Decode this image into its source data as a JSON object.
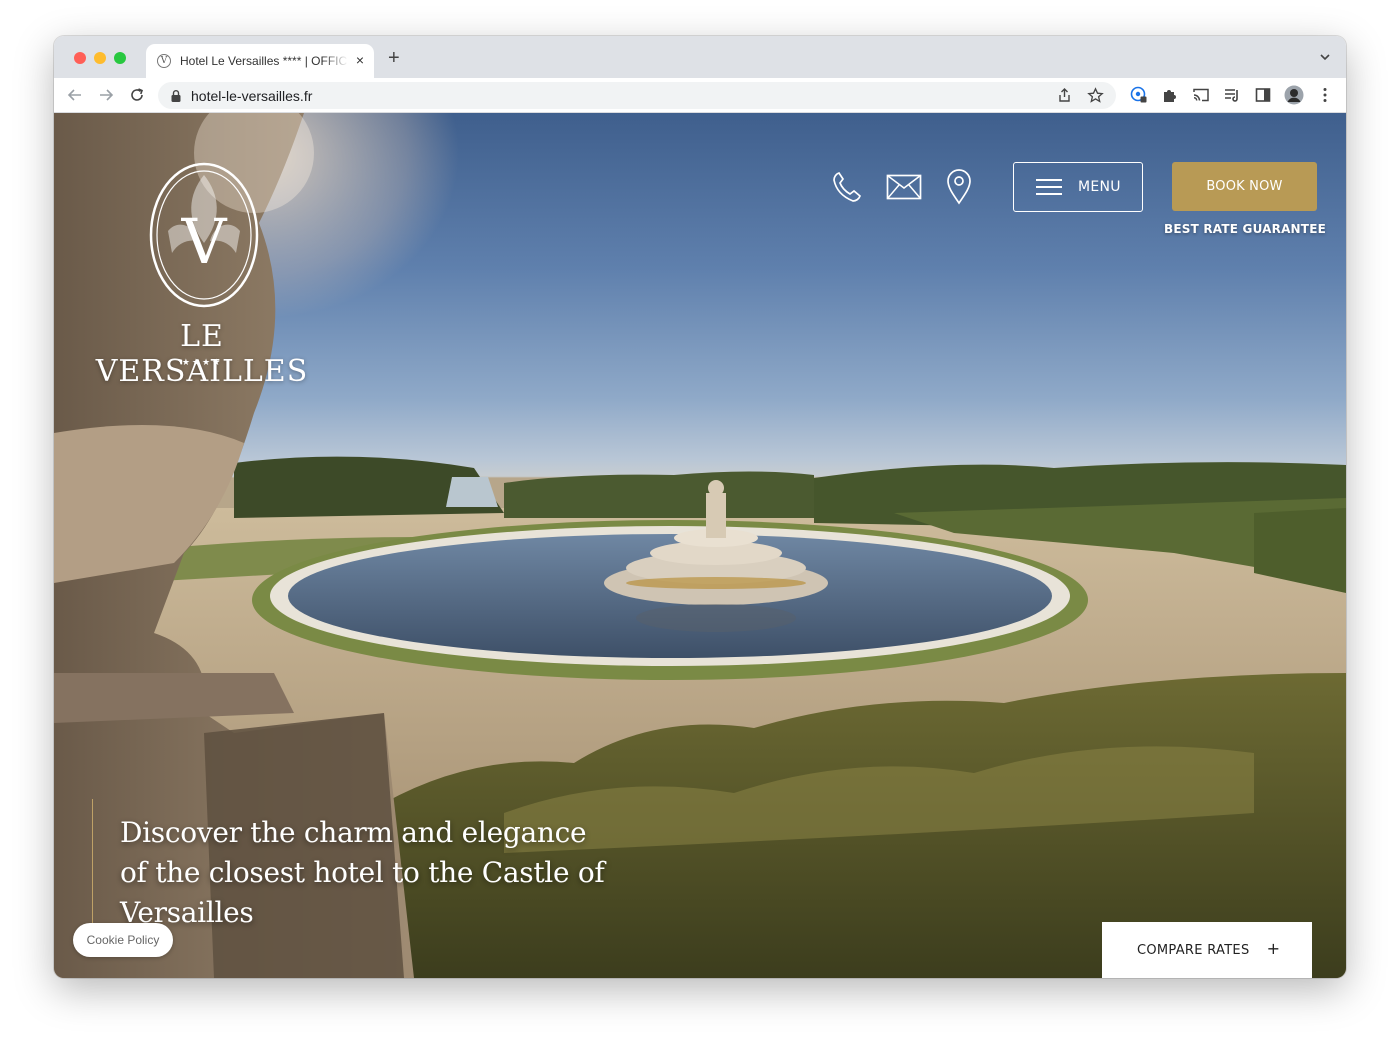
{
  "browser": {
    "tab_title": "Hotel Le Versailles **** | OFFICIAL SITE",
    "tab_favicon": "V",
    "new_tab": "+",
    "tab_close": "×",
    "url": "hotel-le-versailles.fr",
    "icons": [
      "back-icon",
      "forward-icon",
      "reload-icon",
      "lock-icon",
      "share-icon",
      "bookmark-star-icon",
      "extension-icon",
      "puzzle-icon",
      "cast-icon",
      "reading-list-icon",
      "side-panel-icon",
      "profile-avatar",
      "more-icon"
    ]
  },
  "header": {
    "brand_name": "LE VERSAILLES",
    "brand_stars": "★★★★",
    "logo_letter": "V",
    "menu_label": "MENU",
    "book_label": "BOOK NOW",
    "best_rate": "BEST RATE GUARANTEE",
    "icons": [
      "phone-icon",
      "mail-icon",
      "location-pin-icon",
      "hamburger-icon"
    ]
  },
  "hero": {
    "tagline": "Discover the charm and elegance of the closest hotel to the Castle of Versailles"
  },
  "widgets": {
    "cookie_label": "Cookie Policy",
    "compare_label": "COMPARE RATES",
    "compare_plus": "+"
  },
  "colors": {
    "gold": "#b89a55",
    "sky_top": "#3f5f8d",
    "tab_strip": "#dee1e6"
  }
}
